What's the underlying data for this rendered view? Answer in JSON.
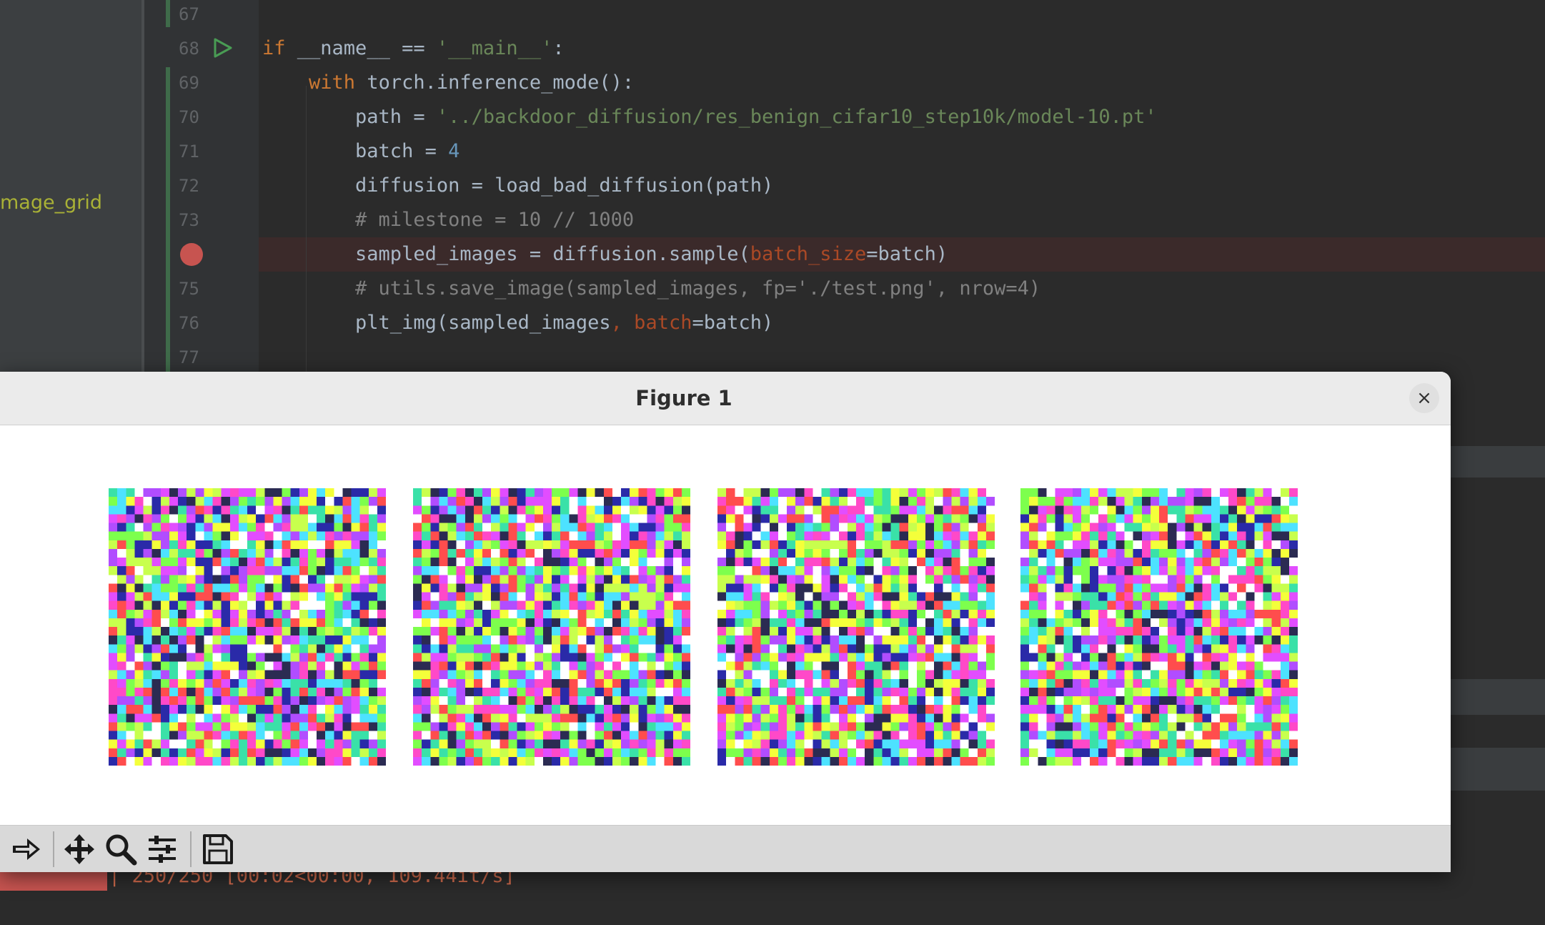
{
  "window_title": "Figure 1",
  "project_panel": {
    "symbol_text": "mage_grid"
  },
  "editor": {
    "lines": [
      {
        "n": "67",
        "parts": []
      },
      {
        "n": "68",
        "parts": [
          [
            "kw",
            "if "
          ],
          [
            "",
            "__name__ == "
          ],
          [
            "str",
            "'__main__'"
          ],
          [
            "",
            ":"
          ]
        ]
      },
      {
        "n": "69",
        "parts": [
          [
            "",
            "    "
          ],
          [
            "kw",
            "with "
          ],
          [
            "",
            "torch.inference_mode():"
          ]
        ]
      },
      {
        "n": "70",
        "parts": [
          [
            "",
            "        path = "
          ],
          [
            "str",
            "'../backdoor_diffusion/res_benign_cifar10_step10k/model-10.pt'"
          ]
        ]
      },
      {
        "n": "71",
        "parts": [
          [
            "",
            "        batch = "
          ],
          [
            "num",
            "4"
          ]
        ]
      },
      {
        "n": "72",
        "parts": [
          [
            "",
            "        diffusion = load_bad_diffusion(path)"
          ]
        ]
      },
      {
        "n": "73",
        "parts": [
          [
            "cmt",
            "        # milestone = 10 // 1000"
          ]
        ]
      },
      {
        "n": "",
        "parts": [
          [
            "",
            "        sampled_images = diffusion.sample("
          ],
          [
            "param",
            "batch_size"
          ],
          [
            "",
            "=batch)"
          ]
        ]
      },
      {
        "n": "75",
        "parts": [
          [
            "cmt",
            "        # utils.save_image(sampled_images, fp='./test.png', nrow=4)"
          ]
        ]
      },
      {
        "n": "76",
        "parts": [
          [
            "",
            "        plt_img(sampled_images"
          ],
          [
            "param",
            ", batch"
          ],
          [
            "",
            "=batch)"
          ]
        ]
      },
      {
        "n": "77",
        "parts": []
      }
    ]
  },
  "console": {
    "progress_text": "| 250/250 [00:02<00:00, 109.44it/s]",
    "progress": 1.0
  },
  "figure": {
    "close_label": "×",
    "images_count": 4,
    "toolbar": [
      "forward-icon",
      "pan-icon",
      "zoom-icon",
      "configure-subplots-icon",
      "save-icon"
    ]
  },
  "colors": {
    "noise_palette": [
      "#ff4d4d",
      "#7dff4d",
      "#e24dff",
      "#4de2ff",
      "#f4ff3a",
      "#2a2aa8",
      "#ff49c8",
      "#3ae1a8",
      "#b14dff",
      "#c8ff4d",
      "#2b2b52",
      "#ffffff"
    ]
  }
}
